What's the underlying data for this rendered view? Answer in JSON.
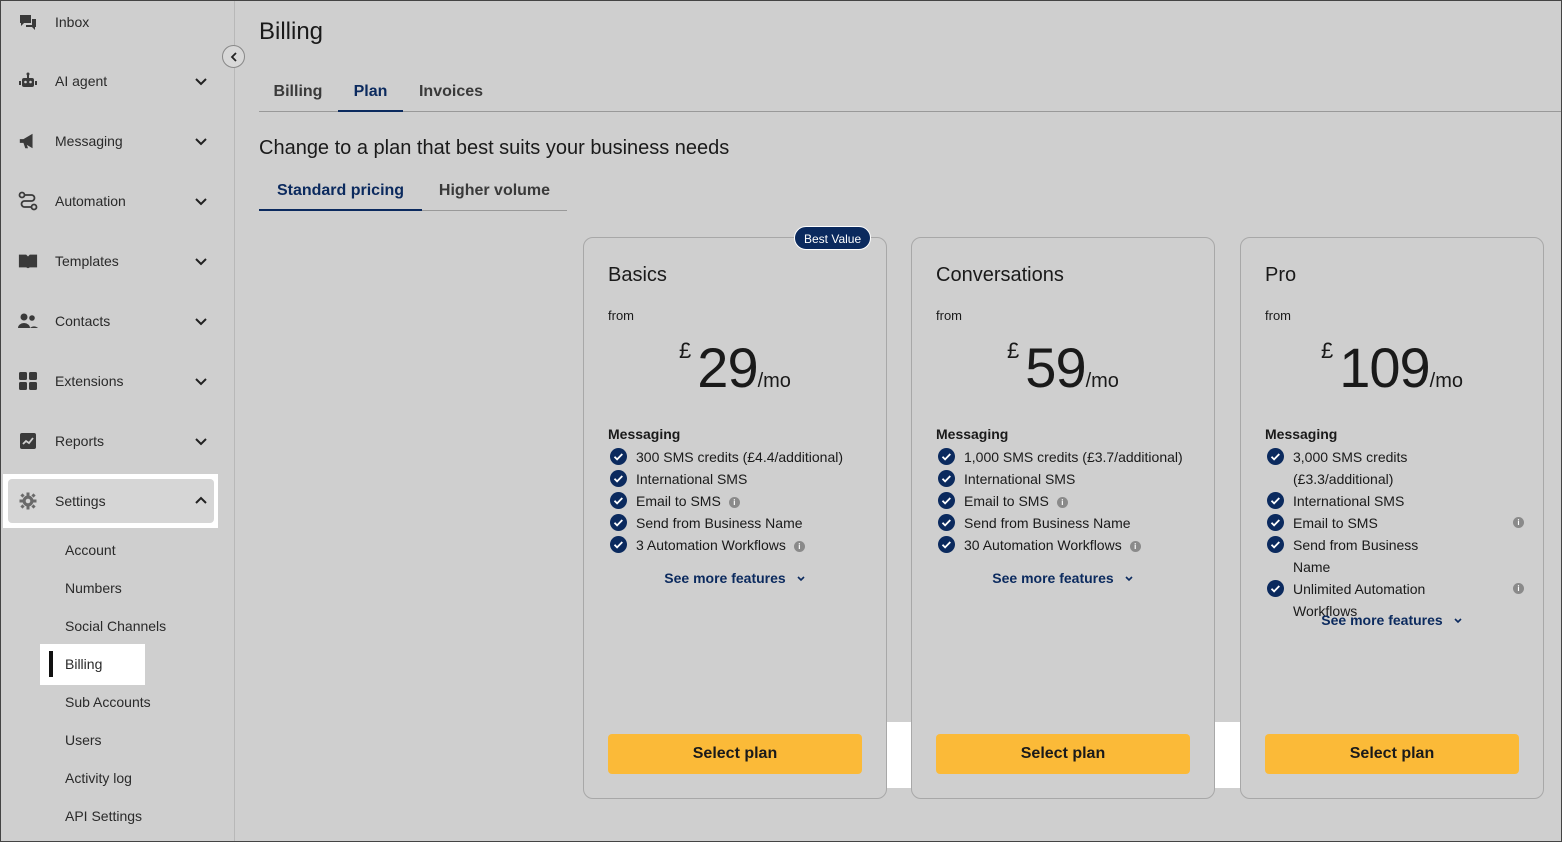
{
  "sidebar": {
    "items": [
      {
        "label": "Inbox",
        "icon": "chat-icon"
      },
      {
        "label": "AI agent",
        "icon": "robot-icon"
      },
      {
        "label": "Messaging",
        "icon": "megaphone-icon"
      },
      {
        "label": "Automation",
        "icon": "flow-icon"
      },
      {
        "label": "Templates",
        "icon": "book-icon"
      },
      {
        "label": "Contacts",
        "icon": "people-icon"
      },
      {
        "label": "Extensions",
        "icon": "grid-icon"
      },
      {
        "label": "Reports",
        "icon": "chart-icon"
      },
      {
        "label": "Settings",
        "icon": "gear-icon"
      }
    ],
    "settings_sub": [
      "Account",
      "Numbers",
      "Social Channels",
      "Billing",
      "Sub Accounts",
      "Users",
      "Activity log",
      "API Settings"
    ]
  },
  "page": {
    "title": "Billing",
    "tabs": [
      "Billing",
      "Plan",
      "Invoices"
    ],
    "active_tab": "Plan",
    "subtitle": "Change to a plan that best suits your business needs",
    "pricing_tabs": [
      "Standard pricing",
      "Higher volume"
    ],
    "active_pricing_tab": "Standard pricing"
  },
  "plans": [
    {
      "name": "Basics",
      "badge": "Best Value",
      "from": "from",
      "currency": "£",
      "amount": "29",
      "period": "/mo",
      "features_heading": "Messaging",
      "features": [
        {
          "text": "300 SMS credits (£4.4/additional)",
          "info": false
        },
        {
          "text": "International SMS",
          "info": false
        },
        {
          "text": "Email to SMS",
          "info": true
        },
        {
          "text": "Send from Business Name",
          "info": false
        },
        {
          "text": "3 Automation Workflows",
          "info": true
        }
      ],
      "see_more": "See more features",
      "cta": "Select plan"
    },
    {
      "name": "Conversations",
      "from": "from",
      "currency": "£",
      "amount": "59",
      "period": "/mo",
      "features_heading": "Messaging",
      "features": [
        {
          "text": "1,000 SMS credits (£3.7/additional)",
          "info": false
        },
        {
          "text": "International SMS",
          "info": false
        },
        {
          "text": "Email to SMS",
          "info": true
        },
        {
          "text": "Send from Business Name",
          "info": false
        },
        {
          "text": "30 Automation Workflows",
          "info": true
        }
      ],
      "see_more": "See more features",
      "cta": "Select plan"
    },
    {
      "name": "Pro",
      "from": "from",
      "currency": "£",
      "amount": "109",
      "period": "/mo",
      "features_heading": "Messaging",
      "features": [
        {
          "text": "3,000 SMS credits (£3.3/additional)",
          "info": false
        },
        {
          "text": "International SMS",
          "info": false
        },
        {
          "text": "Email to SMS",
          "info": true
        },
        {
          "text": "Send from Business Name",
          "info": false
        },
        {
          "text": "Unlimited Automation Workflows",
          "info": true
        }
      ],
      "see_more": "See more features",
      "cta": "Select plan"
    }
  ],
  "colors": {
    "accent": "#0b2a5e",
    "button": "#fbba38",
    "background": "#cfcfcf"
  }
}
